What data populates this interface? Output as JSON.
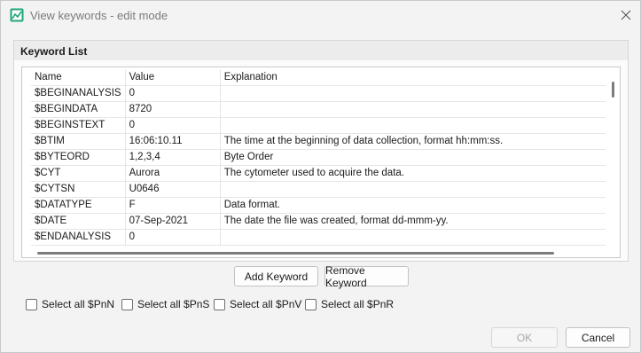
{
  "window": {
    "title": "View keywords - edit mode"
  },
  "group": {
    "title": "Keyword List"
  },
  "table": {
    "columns": [
      "Name",
      "Value",
      "Explanation"
    ],
    "rows": [
      [
        "$BEGINANALYSIS",
        "0",
        ""
      ],
      [
        "$BEGINDATA",
        "8720",
        ""
      ],
      [
        "$BEGINSTEXT",
        "0",
        ""
      ],
      [
        "$BTIM",
        "16:06:10.11",
        "The time at the beginning of data collection, format hh:mm:ss."
      ],
      [
        "$BYTEORD",
        "1,2,3,4",
        "Byte Order"
      ],
      [
        "$CYT",
        "Aurora",
        "The cytometer used to acquire the data."
      ],
      [
        "$CYTSN",
        "U0646",
        ""
      ],
      [
        "$DATATYPE",
        "F",
        "Data format."
      ],
      [
        "$DATE",
        "07-Sep-2021",
        "The date the file was created, format dd-mmm-yy."
      ],
      [
        "$ENDANALYSIS",
        "0",
        ""
      ]
    ]
  },
  "buttons": {
    "add": "Add Keyword",
    "remove": "Remove Keyword",
    "ok": "OK",
    "cancel": "Cancel"
  },
  "checkboxes": [
    "Select all $PnN",
    "Select all $PnS",
    "Select all $PnV",
    "Select all $PnR"
  ],
  "icons": {
    "app": "chart-app-icon",
    "close": "close-icon"
  },
  "colors": {
    "app_icon": "#1fa67a"
  }
}
